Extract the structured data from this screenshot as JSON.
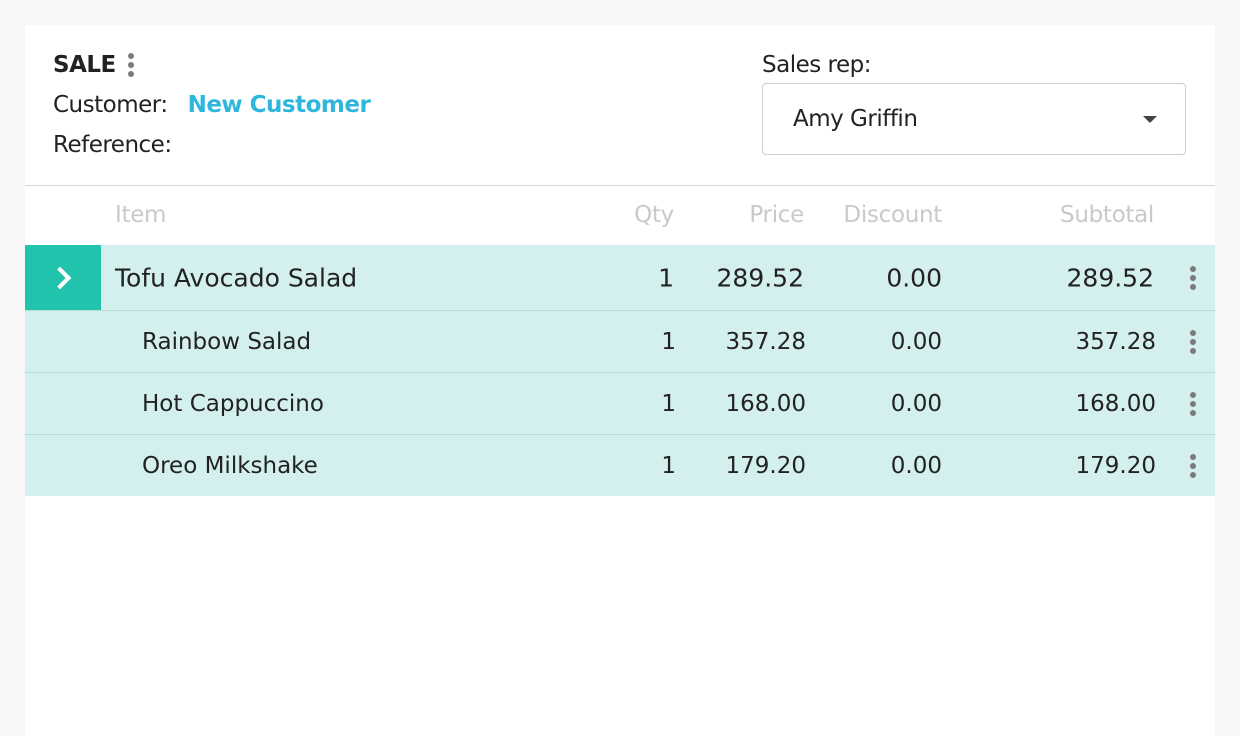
{
  "header": {
    "sale_title": "SALE",
    "customer_label": "Customer:",
    "customer_value": "New Customer",
    "reference_label": "Reference:",
    "salesrep_label": "Sales rep:",
    "salesrep_value": "Amy Griffin"
  },
  "table": {
    "columns": {
      "item": "Item",
      "qty": "Qty",
      "price": "Price",
      "discount": "Discount",
      "subtotal": "Subtotal"
    },
    "rows": [
      {
        "item": "Tofu Avocado Salad",
        "qty": "1",
        "price": "289.52",
        "discount": "0.00",
        "subtotal": "289.52"
      },
      {
        "item": "Rainbow Salad",
        "qty": "1",
        "price": "357.28",
        "discount": "0.00",
        "subtotal": "357.28"
      },
      {
        "item": "Hot Cappuccino",
        "qty": "1",
        "price": "168.00",
        "discount": "0.00",
        "subtotal": "168.00"
      },
      {
        "item": "Oreo Milkshake",
        "qty": "1",
        "price": "179.20",
        "discount": "0.00",
        "subtotal": "179.20"
      }
    ]
  },
  "colors": {
    "accent": "#22c3ac",
    "row_highlight": "#d4f0ee",
    "link": "#2eb6dd"
  },
  "icons": {
    "more": "kebab-menu-icon",
    "expand": "chevron-right-icon",
    "dropdown": "caret-down-icon"
  }
}
